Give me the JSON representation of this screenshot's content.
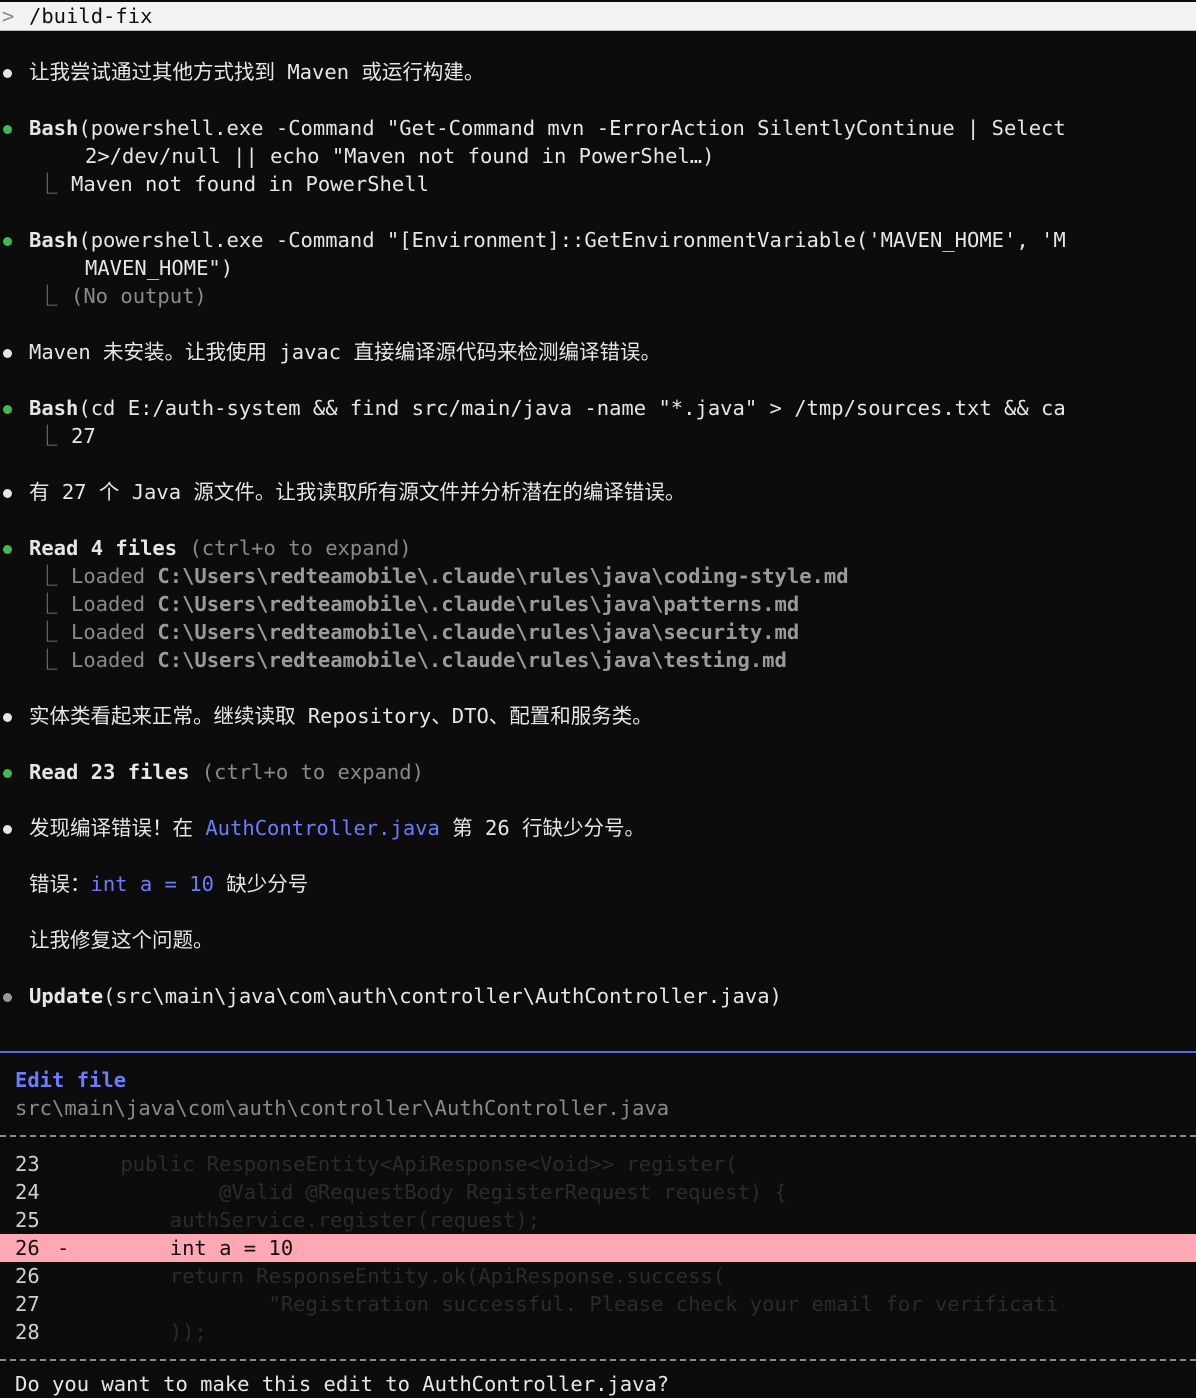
{
  "prompt": {
    "symbol": ">",
    "command": "/build-fix"
  },
  "transcript": {
    "msg1": "让我尝试通过其他方式找到 Maven 或运行构建。",
    "bash1": {
      "tool": "Bash",
      "line1": "(powershell.exe -Command \"Get-Command mvn -ErrorAction SilentlyContinue | Select",
      "line2": "2>/dev/null || echo \"Maven not found in PowerShel…)",
      "result": "Maven not found in PowerShell"
    },
    "bash2": {
      "tool": "Bash",
      "line1": "(powershell.exe -Command \"[Environment]::GetEnvironmentVariable('MAVEN_HOME', 'M",
      "line2": "MAVEN_HOME\")",
      "result": "(No output)"
    },
    "msg2": "Maven 未安装。让我使用 javac 直接编译源代码来检测编译错误。",
    "bash3": {
      "tool": "Bash",
      "line1": "(cd E:/auth-system && find src/main/java -name \"*.java\" > /tmp/sources.txt && ca",
      "result": "27"
    },
    "msg3": "有 27 个 Java 源文件。让我读取所有源文件并分析潜在的编译错误。",
    "read1": {
      "label": "Read 4 files",
      "hint": "(ctrl+o to expand)",
      "loaded_label": "Loaded",
      "files": [
        "C:\\Users\\redteamobile\\.claude\\rules\\java\\coding-style.md",
        "C:\\Users\\redteamobile\\.claude\\rules\\java\\patterns.md",
        "C:\\Users\\redteamobile\\.claude\\rules\\java\\security.md",
        "C:\\Users\\redteamobile\\.claude\\rules\\java\\testing.md"
      ]
    },
    "msg4": "实体类看起来正常。继续读取 Repository、DTO、配置和服务类。",
    "read2": {
      "label": "Read 23 files",
      "hint": "(ctrl+o to expand)"
    },
    "msg5": {
      "before": "发现编译错误！在 ",
      "file": "AuthController.java",
      "after": " 第 26 行缺少分号。"
    },
    "msg6": {
      "before": "错误：",
      "code": "int a = 10",
      "after": " 缺少分号"
    },
    "msg7": "让我修复这个问题。",
    "update": {
      "tool": "Update",
      "path": "(src\\main\\java\\com\\auth\\controller\\AuthController.java)"
    }
  },
  "edit_panel": {
    "title": "Edit file",
    "path": "src\\main\\java\\com\\auth\\controller\\AuthController.java",
    "diff": [
      {
        "ln": "23",
        "marker": "",
        "code": "    public ResponseEntity<ApiResponse<Void>> register("
      },
      {
        "ln": "24",
        "marker": "",
        "code": "            @Valid @RequestBody RegisterRequest request) {"
      },
      {
        "ln": "25",
        "marker": "",
        "code": "        authService.register(request);"
      },
      {
        "ln": "26",
        "marker": "-",
        "code": "        int a = 10"
      },
      {
        "ln": "26",
        "marker": "",
        "code": "        return ResponseEntity.ok(ApiResponse.success("
      },
      {
        "ln": "27",
        "marker": "",
        "code": "                \"Registration successful. Please check your email for verificati"
      },
      {
        "ln": "28",
        "marker": "",
        "code": "        ));"
      }
    ],
    "question_partial": "Do you want to make this edit to AuthController.java?"
  },
  "colors": {
    "accent": "#6b7cff",
    "success_dot": "#3fb950",
    "removed_bg": "#ffa8b4"
  }
}
